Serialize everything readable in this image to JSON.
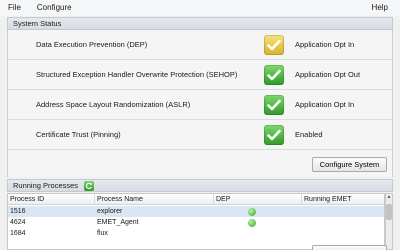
{
  "menu": {
    "file": "File",
    "configure": "Configure",
    "help": "Help"
  },
  "system_status": {
    "title": "System Status",
    "rows": [
      {
        "label": "Data Execution Prevention (DEP)",
        "state": "Application Opt In",
        "indicator": "yellow"
      },
      {
        "label": "Structured Exception Handler Overwrite Protection (SEHOP)",
        "state": "Application Opt Out",
        "indicator": "green"
      },
      {
        "label": "Address Space Layout Randomization (ASLR)",
        "state": "Application Opt In",
        "indicator": "green"
      },
      {
        "label": "Certificate Trust (Pinning)",
        "state": "Enabled",
        "indicator": "green"
      }
    ],
    "configure_button": "Configure System"
  },
  "processes": {
    "title": "Running Processes",
    "columns": [
      "Process ID",
      "Process Name",
      "DEP",
      "Running EMET"
    ],
    "rows": [
      {
        "pid": "1516",
        "name": "explorer",
        "dep": true,
        "selected": true
      },
      {
        "pid": "4624",
        "name": "EMET_Agent",
        "dep": true,
        "selected": false
      },
      {
        "pid": "1684",
        "name": "flux",
        "dep": false,
        "selected": false
      }
    ]
  },
  "colors": {
    "yellow_indicator": "#e2c23c",
    "green_indicator": "#3fae37",
    "selection": "#dbe6f4"
  },
  "icons": {
    "check": "check-icon",
    "refresh": "refresh-icon"
  }
}
